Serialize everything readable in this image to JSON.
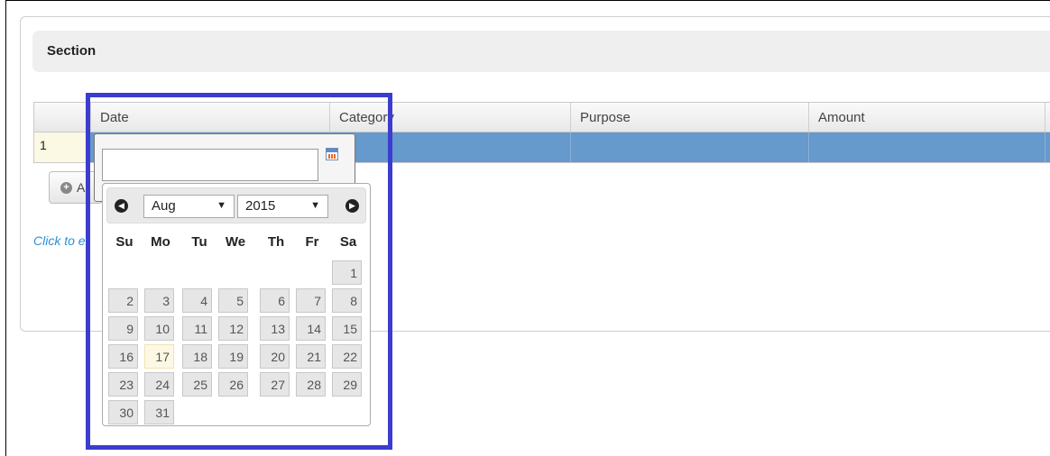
{
  "section": {
    "title": "Section"
  },
  "grid": {
    "columns": [
      "Date",
      "Category",
      "Purpose",
      "Amount"
    ],
    "row_number": "1"
  },
  "add_button": {
    "label": "A"
  },
  "hint": {
    "text": "Click to e"
  },
  "date_editor": {
    "value": "",
    "trigger_icon": "calendar-icon"
  },
  "datepicker": {
    "month": "Aug",
    "year": "2015",
    "prev_icon": "chevron-left-icon",
    "next_icon": "chevron-right-icon",
    "weekdays": [
      "Su",
      "Mo",
      "Tu",
      "We",
      "Th",
      "Fr",
      "Sa"
    ],
    "first_weekday_index": 6,
    "days_in_month": 31,
    "today": 17
  },
  "colors": {
    "selected_row": "#6699cc",
    "row_number_bg": "#fbf8e3",
    "highlight_border": "#3c3ccf",
    "hint_text": "#2a8fd6"
  }
}
